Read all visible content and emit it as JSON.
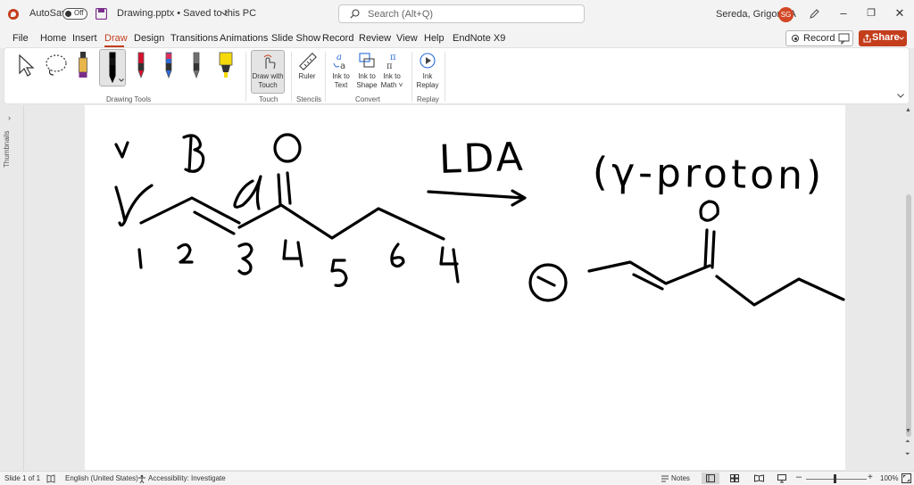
{
  "title_bar": {
    "autosave_label": "AutoSave",
    "autosave_state": "Off",
    "document_title": "Drawing.pptx • Saved to this PC",
    "search_placeholder": "Search (Alt+Q)",
    "user_name": "Sereda, Grigoriy A",
    "user_initials": "SG",
    "window_controls": [
      "–",
      "❐",
      "✕"
    ]
  },
  "menu": {
    "tabs": [
      "File",
      "Home",
      "Insert",
      "Draw",
      "Design",
      "Transitions",
      "Animations",
      "Slide Show",
      "Record",
      "Review",
      "View",
      "Help",
      "EndNote X9"
    ],
    "active_tab": "Draw",
    "record_label": "Record",
    "share_label": "Share"
  },
  "ribbon": {
    "groups": [
      "Drawing Tools",
      "Touch",
      "Stencils",
      "Convert",
      "Replay"
    ],
    "buttons": {
      "draw_with_touch": [
        "Draw with",
        "Touch"
      ],
      "ruler": "Ruler",
      "ink_to_text": [
        "Ink to",
        "Text"
      ],
      "ink_to_shape": [
        "Ink to",
        "Shape"
      ],
      "ink_to_math": [
        "Ink to",
        "Math ˅"
      ],
      "ink_replay": [
        "Ink",
        "Replay"
      ]
    },
    "pen_colors": [
      "#000000",
      "#d8102e",
      "#2b6ad9",
      "#707070",
      "#f2e600"
    ],
    "highlighter_color": "#f5d90a",
    "pencil_color": "#e8b54a"
  },
  "side_pane": {
    "label": "Thumbnails"
  },
  "slide_ink": {
    "greek_labels": [
      "v",
      "β",
      "α"
    ],
    "carbonyl_O": [
      "O",
      "O"
    ],
    "carbon_numbers": [
      "1",
      "2",
      "3",
      "4",
      "5",
      "6",
      "4"
    ],
    "reagent": "LDA",
    "note": "(γ-proton)",
    "anion_charge": "⊖"
  },
  "status_bar": {
    "slide_indicator": "Slide 1 of 1",
    "language": "English (United States)",
    "accessibility": "Accessibility: Investigate",
    "notes_label": "Notes",
    "zoom": "100%"
  }
}
